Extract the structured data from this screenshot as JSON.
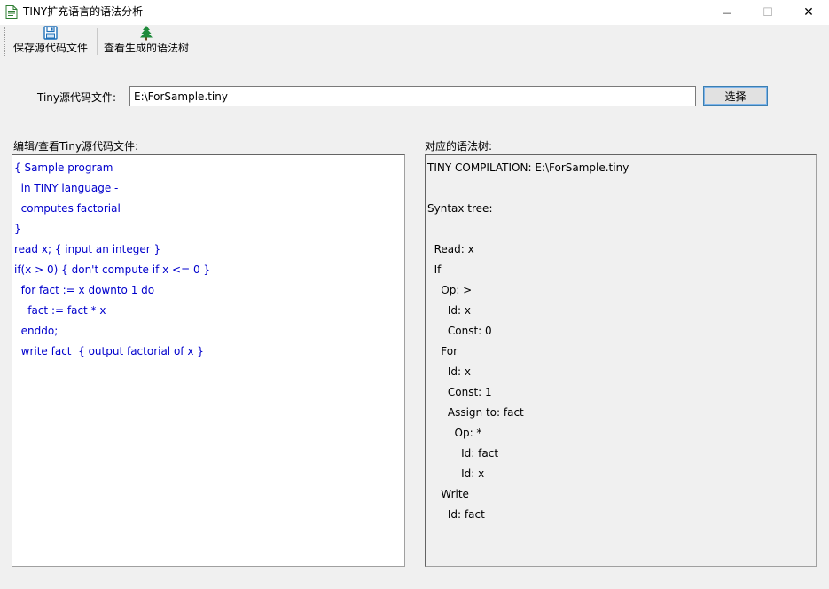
{
  "window": {
    "title": "TINY扩充语言的语法分析",
    "minimize_symbol": "—",
    "maximize_symbol": "☐",
    "close_symbol": "✕"
  },
  "toolbar": {
    "save_label": "保存源代码文件",
    "save_icon": "floppy-disk-icon",
    "view_tree_label": "查看生成的语法树",
    "view_tree_icon": "tree-icon"
  },
  "source": {
    "label": "Tiny源代码文件:",
    "path": "E:\\ForSample.tiny",
    "choose_label": "选择"
  },
  "editor": {
    "label": "编辑/查看Tiny源代码文件:",
    "text_color": "#0000cc",
    "lines": [
      "{ Sample program",
      "  in TINY language -",
      "  computes factorial",
      "}",
      "read x; { input an integer }",
      "if(x > 0) { don't compute if x <= 0 }",
      "  for fact := x downto 1 do",
      "    fact := fact * x",
      "  enddo;",
      "  write fact  { output factorial of x }"
    ]
  },
  "tree": {
    "label": "对应的语法树:",
    "lines": [
      "TINY COMPILATION: E:\\ForSample.tiny",
      "",
      "Syntax tree:",
      "",
      "  Read: x",
      "  If",
      "    Op: >",
      "      Id: x",
      "      Const: 0",
      "    For",
      "      Id: x",
      "      Const: 1",
      "      Assign to: fact",
      "        Op: *",
      "          Id: fact",
      "          Id: x",
      "    Write",
      "      Id: fact"
    ]
  }
}
